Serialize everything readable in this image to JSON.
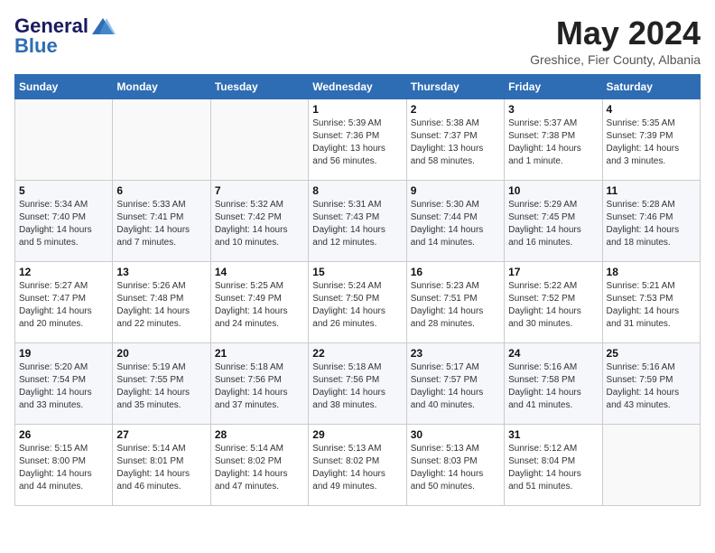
{
  "header": {
    "logo_general": "General",
    "logo_blue": "Blue",
    "month_title": "May 2024",
    "subtitle": "Greshice, Fier County, Albania"
  },
  "weekdays": [
    "Sunday",
    "Monday",
    "Tuesday",
    "Wednesday",
    "Thursday",
    "Friday",
    "Saturday"
  ],
  "weeks": [
    [
      {
        "day": "",
        "info": ""
      },
      {
        "day": "",
        "info": ""
      },
      {
        "day": "",
        "info": ""
      },
      {
        "day": "1",
        "info": "Sunrise: 5:39 AM\nSunset: 7:36 PM\nDaylight: 13 hours\nand 56 minutes."
      },
      {
        "day": "2",
        "info": "Sunrise: 5:38 AM\nSunset: 7:37 PM\nDaylight: 13 hours\nand 58 minutes."
      },
      {
        "day": "3",
        "info": "Sunrise: 5:37 AM\nSunset: 7:38 PM\nDaylight: 14 hours\nand 1 minute."
      },
      {
        "day": "4",
        "info": "Sunrise: 5:35 AM\nSunset: 7:39 PM\nDaylight: 14 hours\nand 3 minutes."
      }
    ],
    [
      {
        "day": "5",
        "info": "Sunrise: 5:34 AM\nSunset: 7:40 PM\nDaylight: 14 hours\nand 5 minutes."
      },
      {
        "day": "6",
        "info": "Sunrise: 5:33 AM\nSunset: 7:41 PM\nDaylight: 14 hours\nand 7 minutes."
      },
      {
        "day": "7",
        "info": "Sunrise: 5:32 AM\nSunset: 7:42 PM\nDaylight: 14 hours\nand 10 minutes."
      },
      {
        "day": "8",
        "info": "Sunrise: 5:31 AM\nSunset: 7:43 PM\nDaylight: 14 hours\nand 12 minutes."
      },
      {
        "day": "9",
        "info": "Sunrise: 5:30 AM\nSunset: 7:44 PM\nDaylight: 14 hours\nand 14 minutes."
      },
      {
        "day": "10",
        "info": "Sunrise: 5:29 AM\nSunset: 7:45 PM\nDaylight: 14 hours\nand 16 minutes."
      },
      {
        "day": "11",
        "info": "Sunrise: 5:28 AM\nSunset: 7:46 PM\nDaylight: 14 hours\nand 18 minutes."
      }
    ],
    [
      {
        "day": "12",
        "info": "Sunrise: 5:27 AM\nSunset: 7:47 PM\nDaylight: 14 hours\nand 20 minutes."
      },
      {
        "day": "13",
        "info": "Sunrise: 5:26 AM\nSunset: 7:48 PM\nDaylight: 14 hours\nand 22 minutes."
      },
      {
        "day": "14",
        "info": "Sunrise: 5:25 AM\nSunset: 7:49 PM\nDaylight: 14 hours\nand 24 minutes."
      },
      {
        "day": "15",
        "info": "Sunrise: 5:24 AM\nSunset: 7:50 PM\nDaylight: 14 hours\nand 26 minutes."
      },
      {
        "day": "16",
        "info": "Sunrise: 5:23 AM\nSunset: 7:51 PM\nDaylight: 14 hours\nand 28 minutes."
      },
      {
        "day": "17",
        "info": "Sunrise: 5:22 AM\nSunset: 7:52 PM\nDaylight: 14 hours\nand 30 minutes."
      },
      {
        "day": "18",
        "info": "Sunrise: 5:21 AM\nSunset: 7:53 PM\nDaylight: 14 hours\nand 31 minutes."
      }
    ],
    [
      {
        "day": "19",
        "info": "Sunrise: 5:20 AM\nSunset: 7:54 PM\nDaylight: 14 hours\nand 33 minutes."
      },
      {
        "day": "20",
        "info": "Sunrise: 5:19 AM\nSunset: 7:55 PM\nDaylight: 14 hours\nand 35 minutes."
      },
      {
        "day": "21",
        "info": "Sunrise: 5:18 AM\nSunset: 7:56 PM\nDaylight: 14 hours\nand 37 minutes."
      },
      {
        "day": "22",
        "info": "Sunrise: 5:18 AM\nSunset: 7:56 PM\nDaylight: 14 hours\nand 38 minutes."
      },
      {
        "day": "23",
        "info": "Sunrise: 5:17 AM\nSunset: 7:57 PM\nDaylight: 14 hours\nand 40 minutes."
      },
      {
        "day": "24",
        "info": "Sunrise: 5:16 AM\nSunset: 7:58 PM\nDaylight: 14 hours\nand 41 minutes."
      },
      {
        "day": "25",
        "info": "Sunrise: 5:16 AM\nSunset: 7:59 PM\nDaylight: 14 hours\nand 43 minutes."
      }
    ],
    [
      {
        "day": "26",
        "info": "Sunrise: 5:15 AM\nSunset: 8:00 PM\nDaylight: 14 hours\nand 44 minutes."
      },
      {
        "day": "27",
        "info": "Sunrise: 5:14 AM\nSunset: 8:01 PM\nDaylight: 14 hours\nand 46 minutes."
      },
      {
        "day": "28",
        "info": "Sunrise: 5:14 AM\nSunset: 8:02 PM\nDaylight: 14 hours\nand 47 minutes."
      },
      {
        "day": "29",
        "info": "Sunrise: 5:13 AM\nSunset: 8:02 PM\nDaylight: 14 hours\nand 49 minutes."
      },
      {
        "day": "30",
        "info": "Sunrise: 5:13 AM\nSunset: 8:03 PM\nDaylight: 14 hours\nand 50 minutes."
      },
      {
        "day": "31",
        "info": "Sunrise: 5:12 AM\nSunset: 8:04 PM\nDaylight: 14 hours\nand 51 minutes."
      },
      {
        "day": "",
        "info": ""
      }
    ]
  ]
}
